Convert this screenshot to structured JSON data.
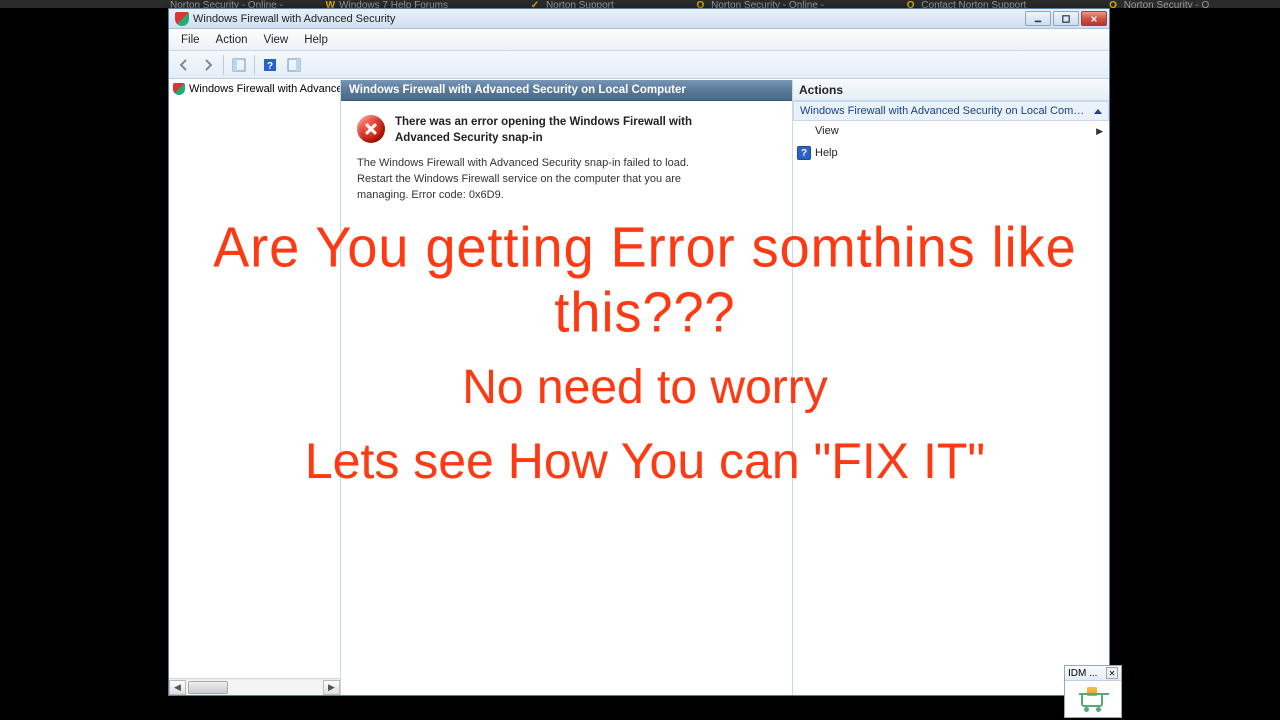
{
  "bgtabs": [
    "Norton Security - Online -",
    "Windows 7 Help Forums",
    "Norton Support",
    "Norton Security - Online -",
    "Contact Norton Support",
    "Norton Security - O"
  ],
  "window": {
    "title": "Windows Firewall with Advanced Security"
  },
  "menubar": [
    "File",
    "Action",
    "View",
    "Help"
  ],
  "tree": {
    "root": "Windows Firewall with Advance"
  },
  "mid": {
    "header": "Windows Firewall with Advanced Security on Local Computer",
    "error_title": "There was an error opening the Windows Firewall with Advanced Security snap-in",
    "error_desc": "The Windows Firewall with Advanced Security snap-in failed to load.  Restart the Windows Firewall service on the computer that you are managing. Error code: 0x6D9."
  },
  "actions": {
    "header": "Actions",
    "group": "Windows Firewall with Advanced Security on Local Compu...",
    "view": "View",
    "help": "Help"
  },
  "overlay": {
    "l1": "Are You getting Error somthins like this???",
    "l2": "No need to worry",
    "l3": "Lets see How You can \"FIX IT\""
  },
  "idm": {
    "title": "IDM ..."
  }
}
